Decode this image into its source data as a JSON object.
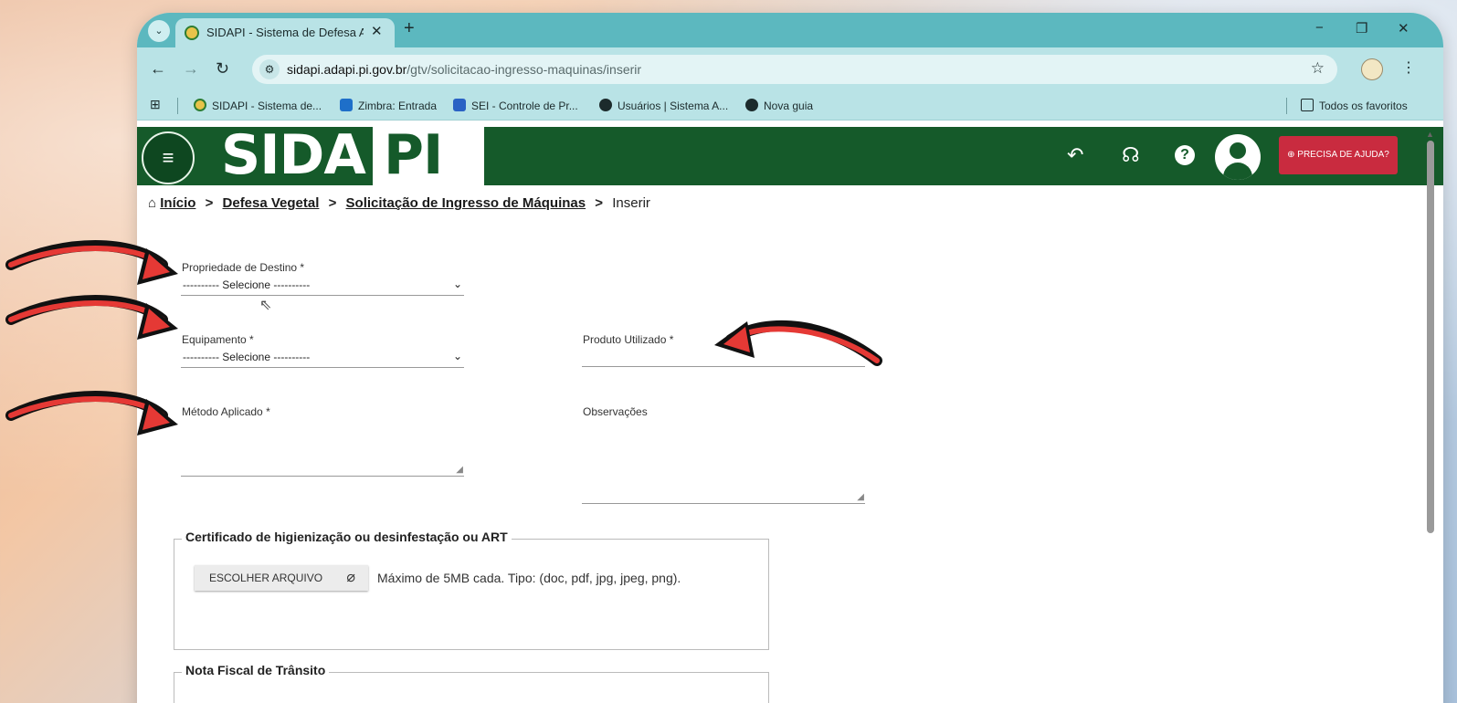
{
  "browser": {
    "tab_title": "SIDAPI - Sistema de Defesa Agr",
    "tab_close": "✕",
    "new_tab": "+",
    "url_host": "sidapi.adapi.pi.gov.br",
    "url_path": "/gtv/solicitacao-ingresso-maquinas/inserir",
    "bookmarks": [
      "SIDAPI - Sistema de...",
      "Zimbra: Entrada",
      "SEI - Controle de Pr...",
      "Usuários | Sistema A...",
      "Nova guia"
    ],
    "all_bookmarks": "Todos os favoritos"
  },
  "header": {
    "logo_left": "SIDA",
    "logo_right": "PI",
    "help_button": "⊕ PRECISA DE AJUDA?"
  },
  "breadcrumb": {
    "home": "Início",
    "level1": "Defesa Vegetal",
    "level2": "Solicitação de Ingresso de Máquinas",
    "current": "Inserir",
    "separator": ">"
  },
  "form": {
    "propriedade_label": "Propriedade de Destino *",
    "propriedade_value": "---------- Selecione ----------",
    "equipamento_label": "Equipamento *",
    "equipamento_value": "---------- Selecione ----------",
    "produto_label": "Produto Utilizado *",
    "metodo_label": "Método Aplicado *",
    "observacoes_label": "Observações",
    "certificado_legend": "Certificado de higienização ou desinfestação ou ART",
    "choose_file": "ESCOLHER ARQUIVO",
    "file_hint": "Máximo de 5MB cada. Tipo: (doc, pdf, jpg, jpeg, png).",
    "nota_legend": "Nota Fiscal de Trânsito"
  },
  "colors": {
    "header_green": "#155a2a",
    "help_red": "#c92b3f",
    "browser_teal": "#5cb8bf",
    "arrow_red": "#e53935"
  }
}
